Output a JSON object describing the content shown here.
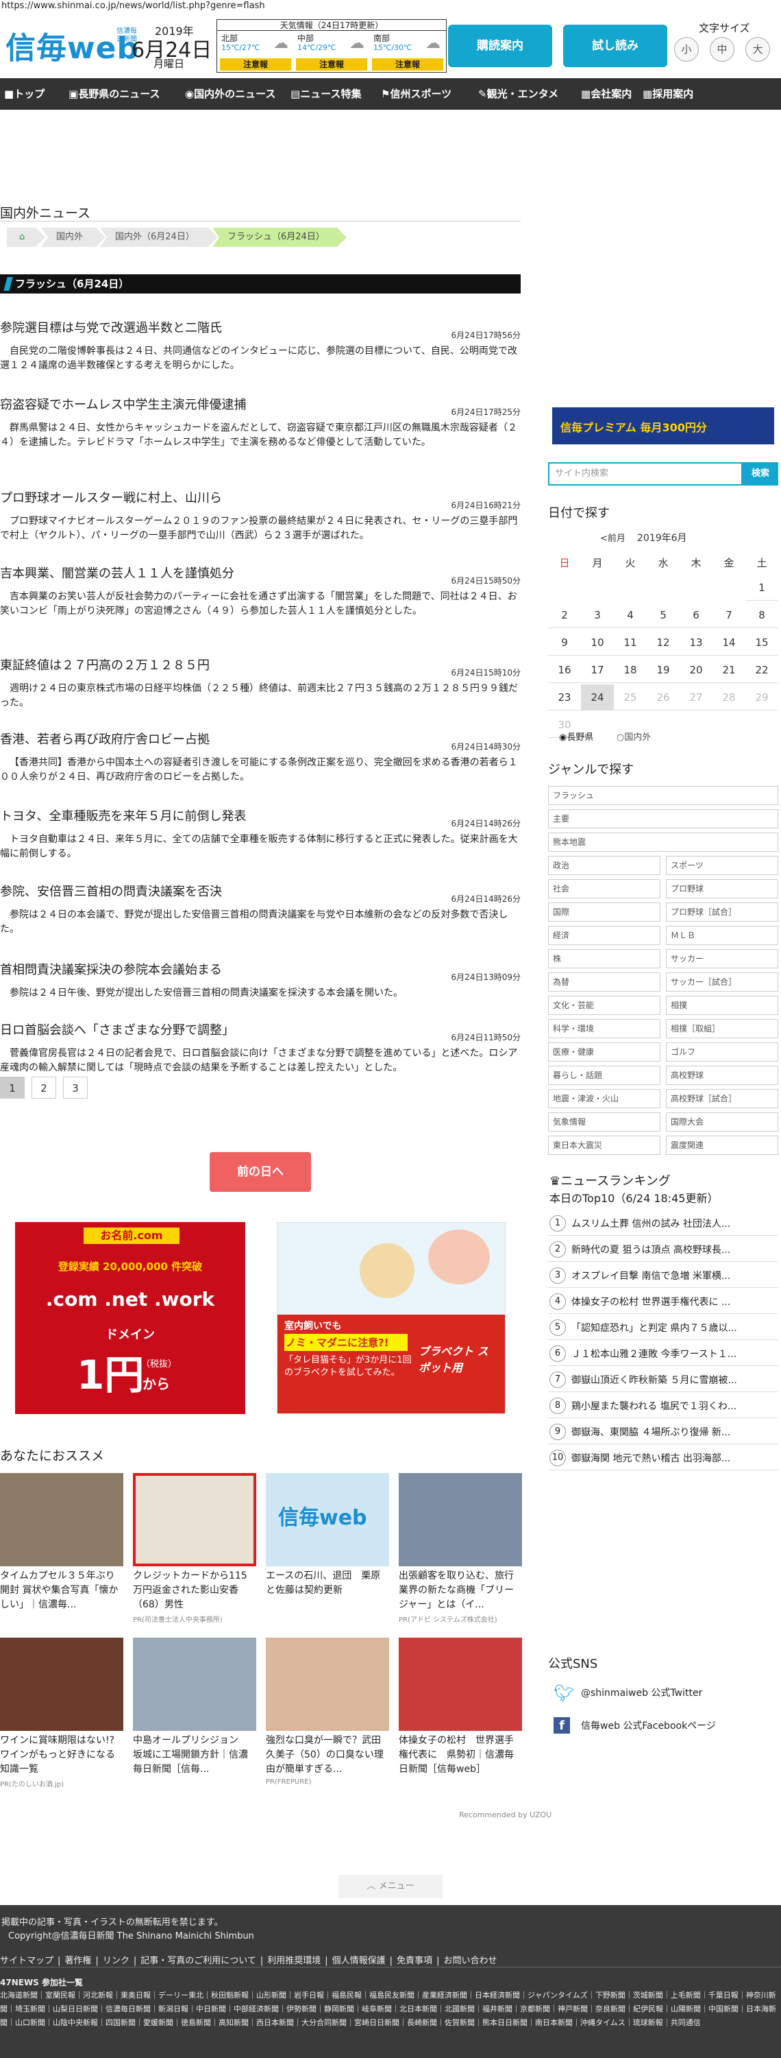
{
  "url": "https://www.shinmai.co.jp/news/world/list.php?genre=flash",
  "header": {
    "logo": "信毎web",
    "logo_sub": "信濃毎日新聞",
    "year": "2019年",
    "date": "6月24日",
    "weekday": "月曜日",
    "weather_title": "天気情報（24日17時更新）",
    "weather": [
      {
        "region": "北部",
        "temp": "15℃/27℃",
        "warn": "注意報"
      },
      {
        "region": "中部",
        "temp": "14℃/29℃",
        "warn": "注意報"
      },
      {
        "region": "南部",
        "temp": "15℃/30℃",
        "warn": "注意報"
      }
    ],
    "btn_subscribe": "購読案内",
    "btn_trial": "試し読み",
    "font_label": "文字サイズ",
    "fonts": [
      "小",
      "中",
      "大"
    ]
  },
  "nav": [
    "トップ",
    "長野県のニュース",
    "国内外のニュース",
    "ニュース特集",
    "信州スポーツ",
    "観光・エンタメ",
    "会社案内",
    "採用案内"
  ],
  "page_title": "国内外ニュース",
  "crumbs": [
    "国内外",
    "国内外（6月24日）",
    "フラッシュ（6月24日）"
  ],
  "section": "フラッシュ（6月24日）",
  "articles": [
    {
      "title": "参院選目標は与党で改選過半数と二階氏",
      "date": "6月24日17時56分",
      "body": "自民党の二階俊博幹事長は２４日、共同通信などのインタビューに応じ、参院選の目標について、自民、公明両党で改選１２４議席の過半数確保とする考えを明らかにした。"
    },
    {
      "title": "窃盗容疑でホームレス中学生主演元俳優逮捕",
      "date": "6月24日17時25分",
      "body": "群馬県警は２４日、女性からキャッシュカードを盗んだとして、窃盗容疑で東京都江戸川区の無職風木宗哉容疑者（２４）を逮捕した。テレビドラマ「ホームレス中学生」で主演を務めるなど俳優として活動していた。"
    },
    {
      "title": "プロ野球オールスター戦に村上、山川ら",
      "date": "6月24日16時21分",
      "body": "プロ野球マイナビオールスターゲーム２０１９のファン投票の最終結果が２４日に発表され、セ・リーグの三塁手部門で村上（ヤクルト）、パ・リーグの一塁手部門で山川（西武）ら２３選手が選ばれた。"
    },
    {
      "title": "吉本興業、闇営業の芸人１１人を謹慎処分",
      "date": "6月24日15時50分",
      "body": "吉本興業のお笑い芸人が反社会勢力のパーティーに会社を通さず出演する「闇営業」をした問題で、同社は２４日、お笑いコンビ「雨上がり決死隊」の宮迫博之さん（４９）ら参加した芸人１１人を謹慎処分とした。"
    },
    {
      "title": "東証終値は２７円高の２万１２８５円",
      "date": "6月24日15時10分",
      "body": "週明け２４日の東京株式市場の日経平均株価（２２５種）終値は、前週末比２７円３５銭高の２万１２８５円９９銭だった。"
    },
    {
      "title": "香港、若者ら再び政府庁舎ロビー占拠",
      "date": "6月24日14時30分",
      "body": "【香港共同】香港から中国本土への容疑者引き渡しを可能にする条例改正案を巡り、完全撤回を求める香港の若者ら１００人余りが２４日、再び政府庁舎のロビーを占拠した。"
    },
    {
      "title": "トヨタ、全車種販売を来年５月に前倒し発表",
      "date": "6月24日14時26分",
      "body": "トヨタ自動車は２４日、来年５月に、全ての店舗で全車種を販売する体制に移行すると正式に発表した。従来計画を大幅に前倒しする。"
    },
    {
      "title": "参院、安倍晋三首相の問責決議案を否決",
      "date": "6月24日14時26分",
      "body": "参院は２４日の本会議で、野党が提出した安倍晋三首相の問責決議案を与党や日本維新の会などの反対多数で否決した。"
    },
    {
      "title": "首相問責決議案採決の参院本会議始まる",
      "date": "6月24日13時09分",
      "body": "参院は２４日午後、野党が提出した安倍晋三首相の問責決議案を採決する本会議を開いた。"
    },
    {
      "title": "日ロ首脳会談へ「さまざまな分野で調整」",
      "date": "6月24日11時50分",
      "body": "菅義偉官房長官は２４日の記者会見で、日ロ首脳会談に向け「さまざまな分野で調整を進めている」と述べた。ロシア産魂肉の輸入解禁に関しては「現時点で会談の結果を予断することは差し控えたい」とした。"
    }
  ],
  "pages": [
    "1",
    "2",
    "3"
  ],
  "prev_day": "前の日へ",
  "ads": {
    "ad1_line1": "お名前.com",
    "ad1_line2": "登録実績 20,000,000 件突破",
    "ad1_line3": ".com .net .work",
    "ad1_line4": "ドメイン",
    "ad1_price": "1円",
    "ad1_tax": "（税抜）",
    "ad1_from": "から",
    "ad2_title": "室内飼いでも",
    "ad2_line": "ノミ・マダニに注意?!",
    "ad2_sub": "「タレ目猫そも」が3か月に1回のブラベクトを試してみた。",
    "ad2_brand": "ブラベクト スポット用"
  },
  "recommend_title": "あなたにおススメ",
  "recommend": [
    {
      "text": "タイムカプセル３５年ぶり開封 賞状や集合写真「懐かしい」｜信濃毎...",
      "pr": ""
    },
    {
      "text": "クレジットカードから115万円返金された影山安香（68）男性",
      "pr": "PR(司法書士法人中央事務所)"
    },
    {
      "text": "エースの石川、退団　栗原と佐藤は契約更新",
      "pr": ""
    },
    {
      "text": "出張顧客を取り込む、旅行業界の新たな商機「ブリージャー」とは（イ...",
      "pr": "PR(アドビ システムズ株式会社)"
    },
    {
      "text": "ワインに賞味期限はない!?ワインがもっと好きになる知識一覧",
      "pr": "PR(たのしいお酒.jp)"
    },
    {
      "text": "中島オールプリシジョン　坂城に工場開鎖方針｜信濃毎日新聞［信毎...",
      "pr": ""
    },
    {
      "text": "強烈な口臭が一瞬で？武田久美子（50）の口臭ない理由が簡単すぎる...",
      "pr": "PR(FREPURE)"
    },
    {
      "text": "体操女子の松村　世界選手権代表に　県勢初｜信濃毎日新聞［信毎web］",
      "pr": ""
    }
  ],
  "recommended_by": "Recommended by UZOU",
  "sidebar": {
    "banner_text": "信毎プレミアム 毎月300円分",
    "search_placeholder": "サイト内検索",
    "search_btn": "検索",
    "date_head": "日付で探す",
    "cal_prev": "<前月",
    "cal_month": "2019年6月",
    "weekdays": [
      "日",
      "月",
      "火",
      "水",
      "木",
      "金",
      "土"
    ],
    "days": [
      "",
      "",
      "",
      "",
      "",
      "",
      "1",
      "2",
      "3",
      "4",
      "5",
      "6",
      "7",
      "8",
      "9",
      "10",
      "11",
      "12",
      "13",
      "14",
      "15",
      "16",
      "17",
      "18",
      "19",
      "20",
      "21",
      "22",
      "23",
      "24",
      "25",
      "26",
      "27",
      "28",
      "29",
      "30",
      "",
      "",
      "",
      "",
      "",
      ""
    ],
    "radio": [
      "長野県",
      "国内外"
    ],
    "genre_head": "ジャンルで探す",
    "genre_full": [
      "フラッシュ",
      "主要",
      "熊本地震"
    ],
    "genres": [
      "政治",
      "スポーツ",
      "社会",
      "プロ野球",
      "国際",
      "プロ野球［試合］",
      "経済",
      "ＭＬＢ",
      "株",
      "サッカー",
      "為替",
      "サッカー［試合］",
      "文化・芸能",
      "相撲",
      "科学・環境",
      "相撲［取組］",
      "医療・健康",
      "ゴルフ",
      "暮らし・話題",
      "高校野球",
      "地震・津波・火山",
      "高校野球［試合］",
      "気象情報",
      "国際大会",
      "東日本大震災",
      "震度関連"
    ],
    "rank_head": "ニュースランキング",
    "rank_sub": "本日のTop10（6/24 18:45更新）",
    "ranking": [
      "ムスリム土葬 信州の試み 社団法人...",
      "新時代の夏 狙うは頂点 高校野球長...",
      "オスプレイ目撃 南信で急増 米軍横...",
      "体操女子の松村 世界選手権代表に ...",
      "「認知症恐れ」と判定 県内７５歳以...",
      "Ｊ１松本山雅２連敗 今季ワースト１...",
      "御嶽山頂近く昨秋新築 ５月に雪崩被...",
      "鶏小屋また襲われる 塩尻で１羽くわ...",
      "御嶽海、東関脇 ４場所ぶり復帰 新...",
      "御嶽海関 地元で熱い稽古 出羽海部..."
    ],
    "sns_head": "公式SNS",
    "sns": [
      "@shinmaiweb 公式Twitter",
      "信毎web 公式Facebookページ"
    ]
  },
  "menu": "メニュー",
  "footer": {
    "notice": "掲載中の記事・写真・イラストの無断転用を禁じます。",
    "copyright": "Copyright@信濃毎日新聞 The Shinano Mainichi Shimbun",
    "links": [
      "サイトマップ",
      "著作権",
      "リンク",
      "記事・写真のご利用について",
      "利用推奨環境",
      "個人情報保護",
      "免責事項",
      "お問い合わせ"
    ],
    "group_title": "47NEWS 参加社一覧",
    "papers": "北海道新聞｜室蘭民報｜河北新報｜東奥日報｜デーリー東北｜秋田魁新報｜山形新聞｜岩手日報｜福島民報｜福島民友新聞｜産業経済新聞｜日本経済新聞｜ジャパンタイムズ｜下野新聞｜茨城新聞｜上毛新聞｜千葉日報｜神奈川新聞｜埼玉新聞｜山梨日日新聞｜信濃毎日新聞｜新潟日報｜中日新聞｜中部経済新聞｜伊勢新聞｜静岡新聞｜岐阜新聞｜北日本新聞｜北國新聞｜福井新聞｜京都新聞｜神戸新聞｜奈良新聞｜紀伊民報｜山陽新聞｜中国新聞｜日本海新聞｜山口新聞｜山陰中央新報｜四国新聞｜愛媛新聞｜徳島新聞｜高知新聞｜西日本新聞｜大分合同新聞｜宮崎日日新聞｜長崎新聞｜佐賀新聞｜熊本日日新聞｜南日本新聞｜沖縄タイムス｜琉球新報｜共同通信"
  },
  "colors": {
    "accent": "#13a6cf",
    "nav": "#333333",
    "logo": "#1a8fd1",
    "prev_day": "#f06161",
    "warn": "#f5c400"
  }
}
